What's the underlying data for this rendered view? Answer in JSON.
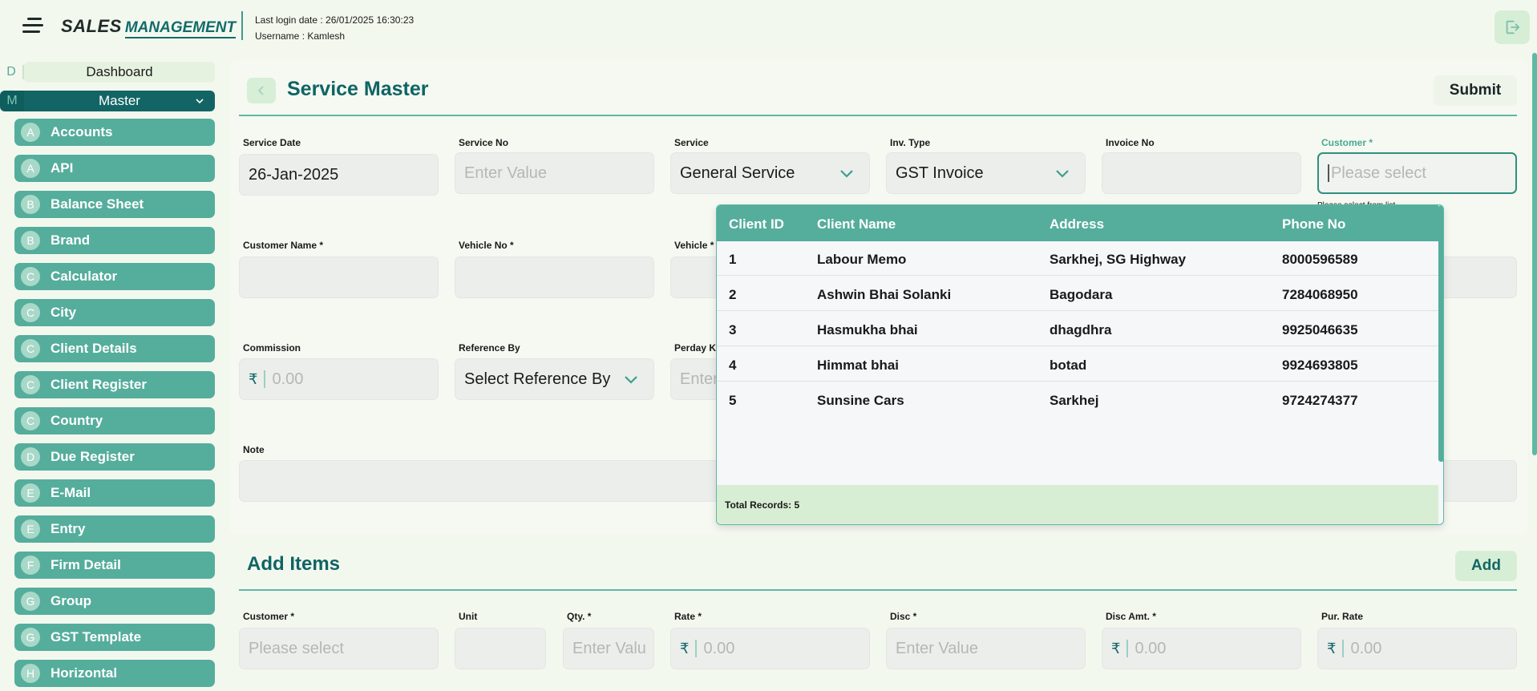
{
  "header": {
    "brand_line1": "SALES",
    "brand_line2": "MANAGEMENT",
    "last_login": "Last login date : 26/01/2025 16:30:23",
    "username": "Username : Kamlesh"
  },
  "sidebar": {
    "dashboard": {
      "letter": "D",
      "label": "Dashboard"
    },
    "master": {
      "letter": "M",
      "label": "Master"
    },
    "items": [
      {
        "badge": "A",
        "label": "Accounts"
      },
      {
        "badge": "A",
        "label": "API"
      },
      {
        "badge": "B",
        "label": "Balance Sheet"
      },
      {
        "badge": "B",
        "label": "Brand"
      },
      {
        "badge": "C",
        "label": "Calculator"
      },
      {
        "badge": "C",
        "label": "City"
      },
      {
        "badge": "C",
        "label": "Client Details"
      },
      {
        "badge": "C",
        "label": "Client Register"
      },
      {
        "badge": "C",
        "label": "Country"
      },
      {
        "badge": "D",
        "label": "Due Register"
      },
      {
        "badge": "E",
        "label": "E-Mail"
      },
      {
        "badge": "E",
        "label": "Entry"
      },
      {
        "badge": "F",
        "label": "Firm Detail"
      },
      {
        "badge": "G",
        "label": "Group"
      },
      {
        "badge": "G",
        "label": "GST Template"
      },
      {
        "badge": "H",
        "label": "Horizontal"
      }
    ]
  },
  "page": {
    "title": "Service Master",
    "submit_label": "Submit"
  },
  "form": {
    "service_date": {
      "label": "Service Date",
      "value": "26-Jan-2025"
    },
    "service_no": {
      "label": "Service No",
      "placeholder": "Enter Value"
    },
    "service": {
      "label": "Service",
      "value": "General Service"
    },
    "inv_type": {
      "label": "Inv. Type",
      "value": "GST Invoice"
    },
    "invoice_no": {
      "label": "Invoice No",
      "value": ""
    },
    "customer": {
      "label": "Customer *",
      "placeholder": "Please select",
      "hint": "Please select from list"
    },
    "customer_name": {
      "label": "Customer Name *",
      "value": ""
    },
    "vehicle_no": {
      "label": "Vehicle No *",
      "value": ""
    },
    "vehicle": {
      "label": "Vehicle *",
      "value": ""
    },
    "commission": {
      "label": "Commission",
      "currency": "₹",
      "placeholder": "0.00"
    },
    "reference_by": {
      "label": "Reference By",
      "value": "Select Reference By"
    },
    "perday_km": {
      "label": "Perday KM",
      "placeholder": "Enter Value"
    },
    "note": {
      "label": "Note",
      "value": ""
    }
  },
  "customer_dropdown": {
    "columns": [
      "Client ID",
      "Client Name",
      "Address",
      "Phone No"
    ],
    "rows": [
      {
        "id": "1",
        "name": "Labour Memo",
        "address": "Sarkhej, SG Highway",
        "phone": "8000596589"
      },
      {
        "id": "2",
        "name": "Ashwin Bhai Solanki",
        "address": "Bagodara",
        "phone": "7284068950"
      },
      {
        "id": "3",
        "name": "Hasmukha bhai",
        "address": "dhagdhra",
        "phone": "9925046635"
      },
      {
        "id": "4",
        "name": "Himmat bhai",
        "address": "botad",
        "phone": "9924693805"
      },
      {
        "id": "5",
        "name": "Sunsine Cars",
        "address": "Sarkhej",
        "phone": "9724274377"
      }
    ],
    "total_records": "Total Records: 5"
  },
  "add_items": {
    "title": "Add Items",
    "add_label": "Add",
    "customer": {
      "label": "Customer *",
      "placeholder": "Please select"
    },
    "unit": {
      "label": "Unit",
      "value": ""
    },
    "qty": {
      "label": "Qty. *",
      "placeholder": "Enter Valu"
    },
    "rate": {
      "label": "Rate *",
      "currency": "₹",
      "placeholder": "0.00"
    },
    "disc": {
      "label": "Disc *",
      "placeholder": "Enter Value"
    },
    "disc_amt": {
      "label": "Disc Amt. *",
      "currency": "₹",
      "placeholder": "0.00"
    },
    "pur_rate": {
      "label": "Pur. Rate",
      "currency": "₹",
      "placeholder": "0.00"
    }
  },
  "colors": {
    "primary_dark": "#126b6b",
    "primary": "#55ad9c",
    "background": "#f3f8ee",
    "field_bg": "#eceeec"
  },
  "icons": [
    "hamburger-icon",
    "logout-icon",
    "chevron-down-icon",
    "chevron-left-icon",
    "rupee-icon"
  ]
}
